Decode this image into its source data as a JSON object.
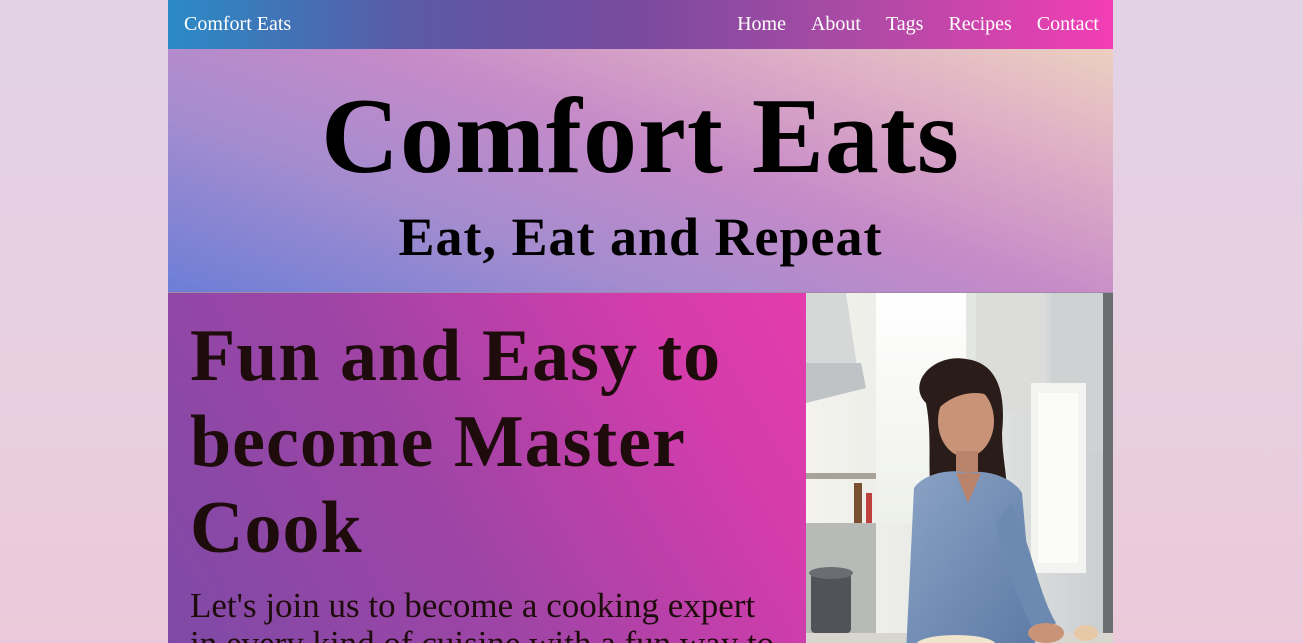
{
  "navbar": {
    "brand": "Comfort Eats",
    "links": [
      "Home",
      "About",
      "Tags",
      "Recipes",
      "Contact"
    ]
  },
  "hero": {
    "title": "Comfort Eats",
    "subtitle": "Eat, Eat and Repeat"
  },
  "feature": {
    "heading": "Fun and Easy to become Master Cook",
    "body": "Let's join us to become a cooking expert in every kind of cuisine with a fun way to"
  },
  "colors": {
    "nav_start": "#2a8bc6",
    "nav_end": "#f33db4",
    "feature_start": "#7e4aa6",
    "feature_end": "#e43cac",
    "heading_text": "#1e0c0c"
  }
}
